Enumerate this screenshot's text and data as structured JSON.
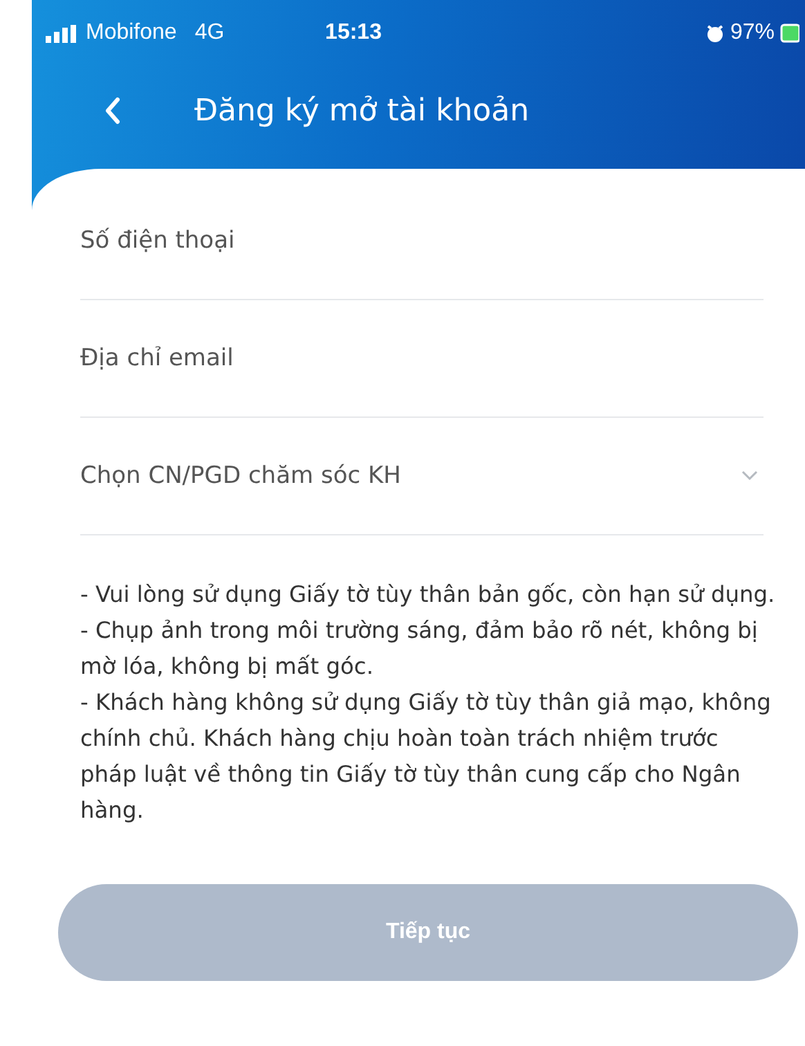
{
  "status_bar": {
    "carrier": "Mobifone",
    "network": "4G",
    "time": "15:13",
    "battery": "97%"
  },
  "header": {
    "title": "Đăng ký mở tài khoản"
  },
  "fields": [
    {
      "kind": "text",
      "placeholder": "Số điện thoại"
    },
    {
      "kind": "text",
      "placeholder": "Địa chỉ email"
    },
    {
      "kind": "dropdown",
      "placeholder": "Chọn CN/PGD chăm sóc KH"
    }
  ],
  "notes": [
    "- Vui lòng sử dụng Giấy tờ tùy thân bản gốc, còn hạn sử dụng.",
    "- Chụp ảnh trong môi trường sáng, đảm bảo rõ nét, không bị mờ lóa, không bị mất góc.",
    "- Khách hàng không sử dụng Giấy tờ tùy thân giả mạo, không chính chủ. Khách hàng chịu hoàn toàn trách nhiệm trước pháp luật về thông tin Giấy tờ tùy thân cung cấp cho Ngân hàng."
  ],
  "continue_button": {
    "label": "Tiếp tục",
    "disabled": true
  }
}
